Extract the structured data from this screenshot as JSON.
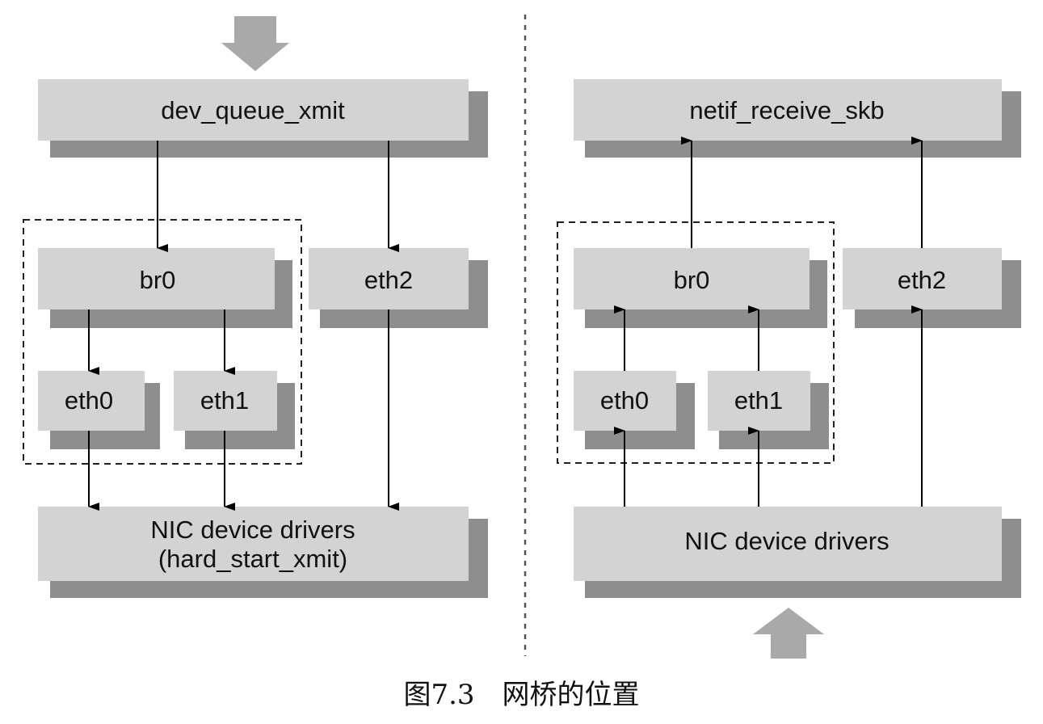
{
  "colors": {
    "box_fill": "#d3d3d3",
    "box_shadow": "#8e8e8e",
    "big_arrow": "#a9a9a9",
    "line": "#000000"
  },
  "transmit": {
    "top_label": "dev_queue_xmit",
    "bridge_label": "br0",
    "eth2_label": "eth2",
    "eth0_label": "eth0",
    "eth1_label": "eth1",
    "driver_line1": "NIC device drivers",
    "driver_line2": "(hard_start_xmit)"
  },
  "receive": {
    "top_label": "netif_receive_skb",
    "bridge_label": "br0",
    "eth2_label": "eth2",
    "eth0_label": "eth0",
    "eth1_label": "eth1",
    "driver_label": "NIC device drivers"
  },
  "caption": "图7.3　网桥的位置"
}
